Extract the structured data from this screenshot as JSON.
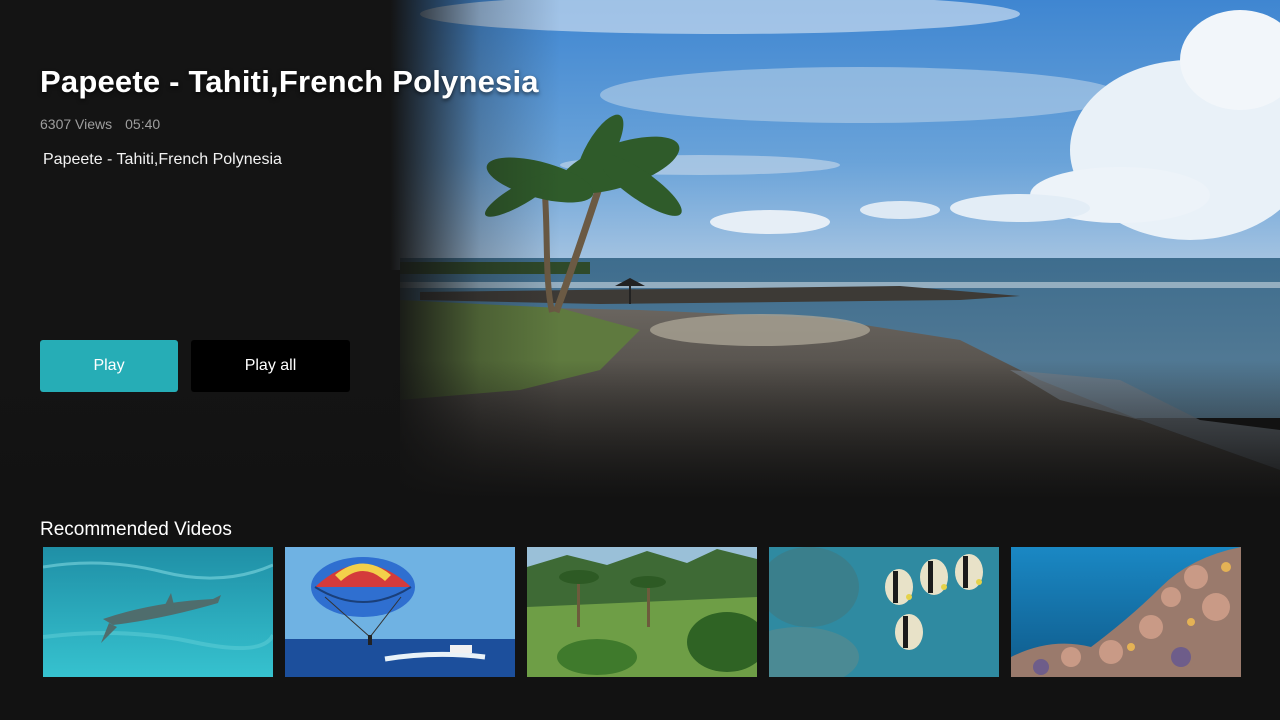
{
  "video": {
    "title": "Papeete - Tahiti,French Polynesia",
    "views": "6307 Views",
    "duration": "05:40",
    "description": "Papeete - Tahiti,French Polynesia"
  },
  "actions": {
    "play_label": "Play",
    "play_all_label": "Play all"
  },
  "recommended": {
    "heading": "Recommended Videos",
    "items": [
      {
        "scene": "shark-underwater"
      },
      {
        "scene": "parasailing"
      },
      {
        "scene": "tropical-valley"
      },
      {
        "scene": "butterflyfish-reef"
      },
      {
        "scene": "coral-reef"
      }
    ]
  },
  "colors": {
    "accent": "#26adb6",
    "background": "#121212",
    "secondary_button": "#000000"
  }
}
